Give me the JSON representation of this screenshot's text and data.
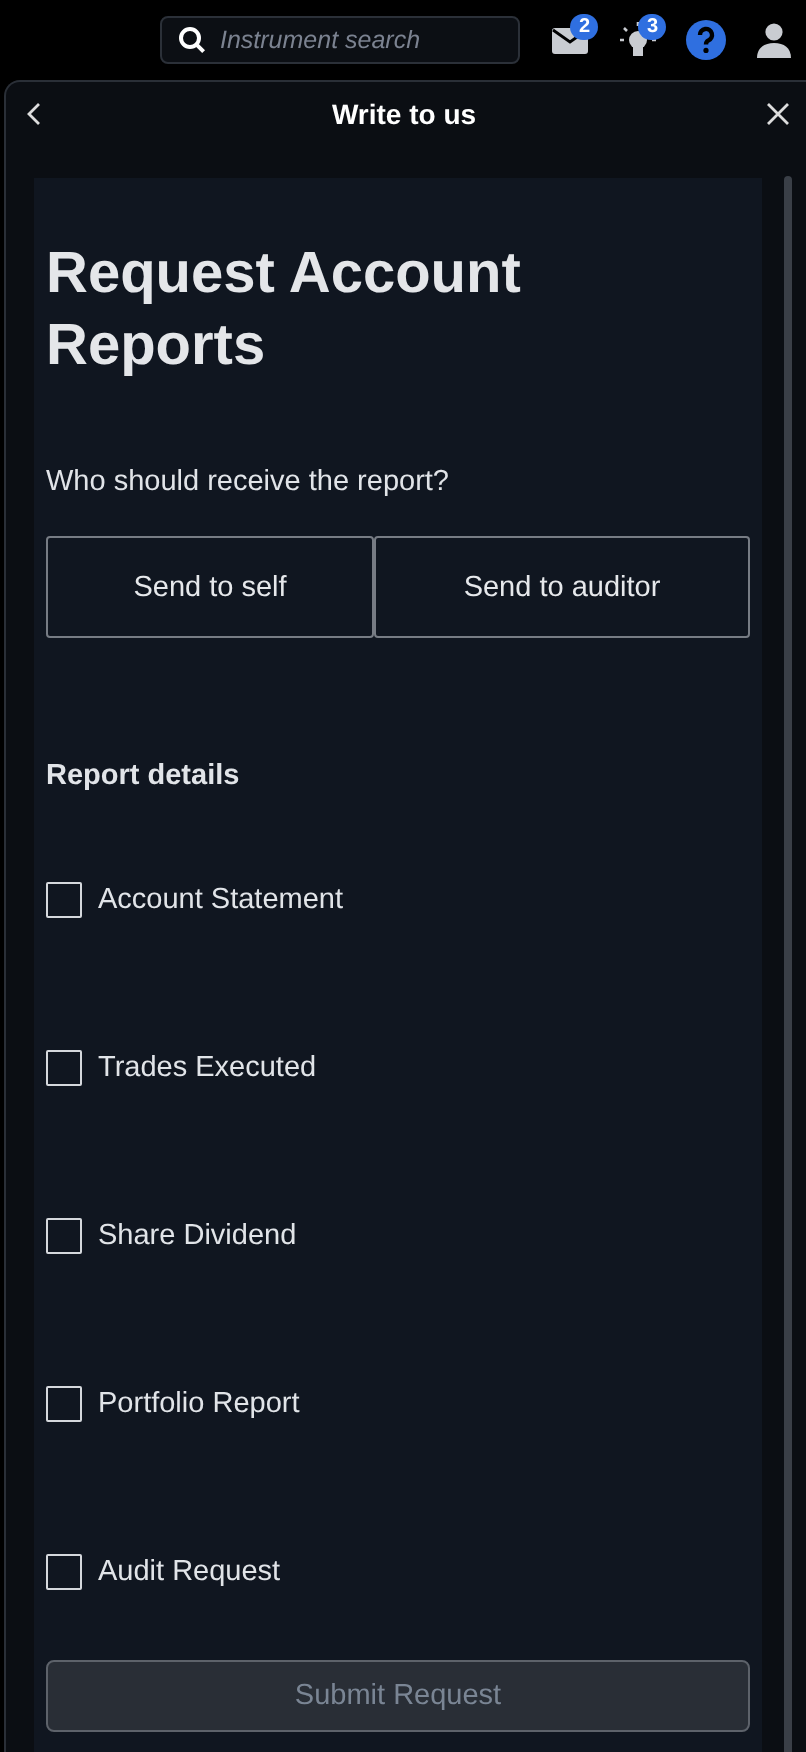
{
  "top_bar": {
    "search": {
      "placeholder": "Instrument search"
    },
    "icons": [
      {
        "kind": "mail",
        "badge": "2"
      },
      {
        "kind": "bulb",
        "badge": "3"
      },
      {
        "kind": "help"
      },
      {
        "kind": "user"
      }
    ]
  },
  "dialog": {
    "title": "Write to us"
  },
  "form": {
    "heading": "Request Account Reports",
    "question": "Who should receive the report?",
    "recipients": [
      {
        "label": "Send to self",
        "selected": false
      },
      {
        "label": "Send to auditor",
        "selected": false
      }
    ],
    "details_label": "Report details",
    "options": [
      {
        "label": "Account Statement",
        "checked": false
      },
      {
        "label": "Trades Executed",
        "checked": false
      },
      {
        "label": "Share Dividend",
        "checked": false
      },
      {
        "label": "Portfolio Report",
        "checked": false
      },
      {
        "label": "Audit Request",
        "checked": false
      }
    ],
    "submit": {
      "label": "Submit Request",
      "disabled": true
    }
  }
}
